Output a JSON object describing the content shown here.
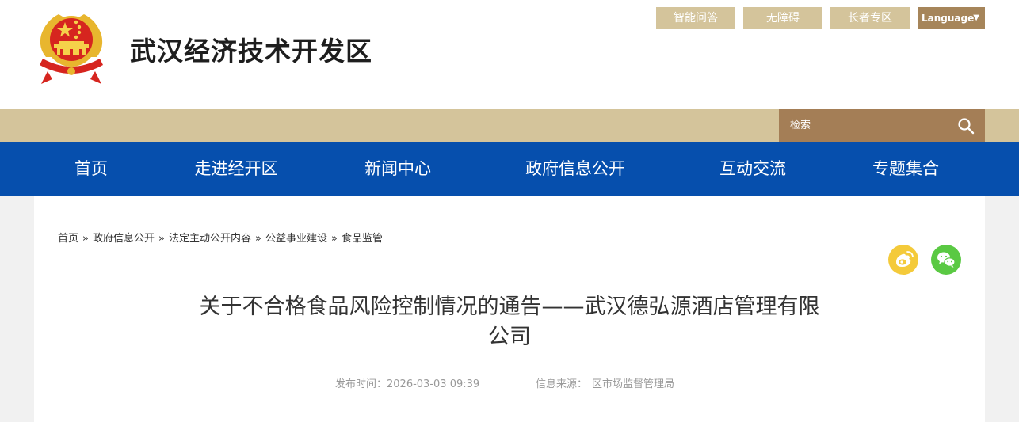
{
  "site": {
    "title": "武汉经济技术开发区",
    "emblem_icon": "national-emblem-icon"
  },
  "top_links": {
    "smart_qa": "智能问答",
    "accessibility": "无障碍",
    "elderly": "长者专区",
    "language": "Language",
    "language_arrow": "▼"
  },
  "search": {
    "placeholder": "检索"
  },
  "nav": {
    "items": [
      "首页",
      "走进经开区",
      "新闻中心",
      "政府信息公开",
      "互动交流",
      "专题集合"
    ]
  },
  "breadcrumb": {
    "items": [
      "首页",
      "政府信息公开",
      "法定主动公开内容",
      "公益事业建设",
      "食品监管"
    ],
    "separator": "»"
  },
  "share": {
    "weibo_icon": "weibo-icon",
    "wechat_icon": "wechat-icon"
  },
  "article": {
    "title": "关于不合格食品风险控制情况的通告——武汉德弘源酒店管理有限公司",
    "publish_label": "发布时间：",
    "publish_time": "2026-03-03 09:39",
    "source_label": "信息来源：",
    "source": "区市场监督管理局"
  },
  "colors": {
    "nav_blue": "#064fad",
    "tan": "#d4c49b",
    "brown": "#a47e56",
    "weibo": "#f4ca3a",
    "wechat": "#5ac943"
  }
}
